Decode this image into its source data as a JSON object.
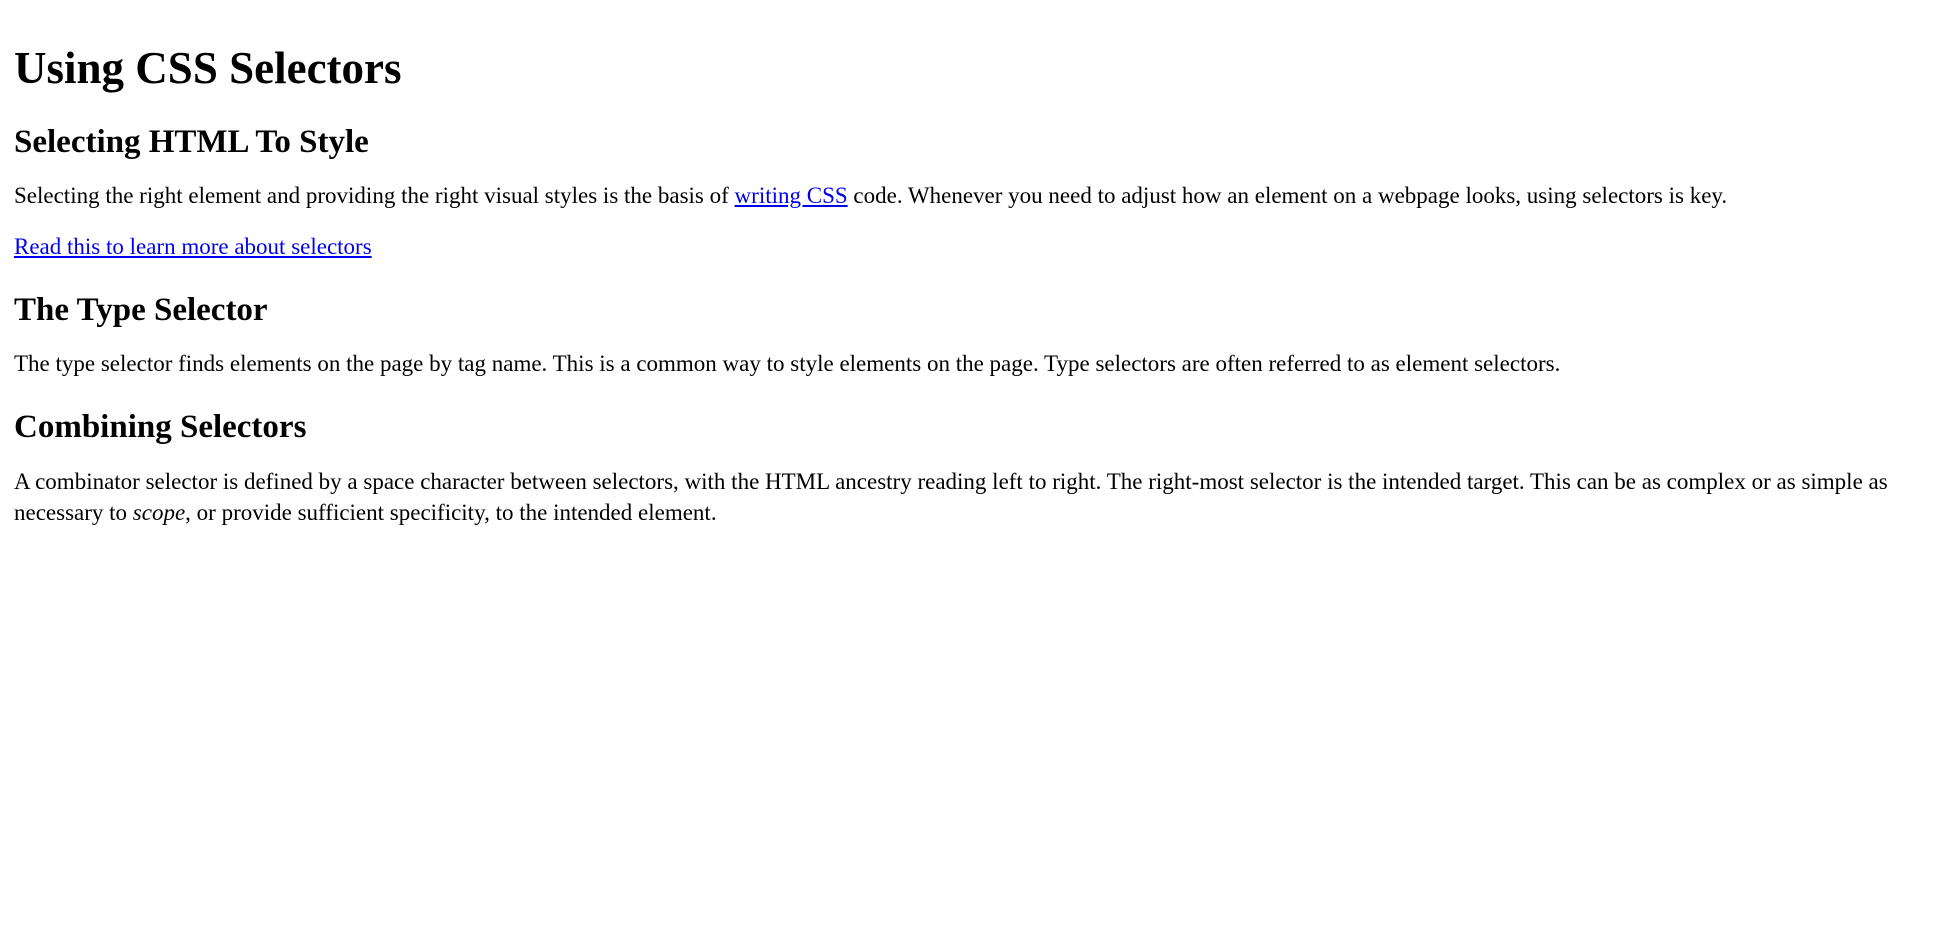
{
  "title": "Using CSS Selectors",
  "section1": {
    "heading": "Selecting HTML To Style",
    "p1_part1": "Selecting the right element and providing the right visual styles is the basis of ",
    "p1_link": "writing CSS",
    "p1_part2": " code. Whenever you need to adjust how an element on a webpage looks, using selectors is key.",
    "p2_link": "Read this to learn more about selectors"
  },
  "section2": {
    "heading": "The Type Selector",
    "p1": "The type selector finds elements on the page by tag name. This is a common way to style elements on the page. Type selectors are often referred to as element selectors."
  },
  "section3": {
    "heading": "Combining Selectors",
    "p1_part1": "A combinator selector is defined by a space character between selectors, with the HTML ancestry reading left to right. The right-most selector is the intended target. This can be as complex or as simple as necessary to ",
    "p1_em": "scope",
    "p1_part2": ", or provide sufficient specificity, to the intended element."
  }
}
